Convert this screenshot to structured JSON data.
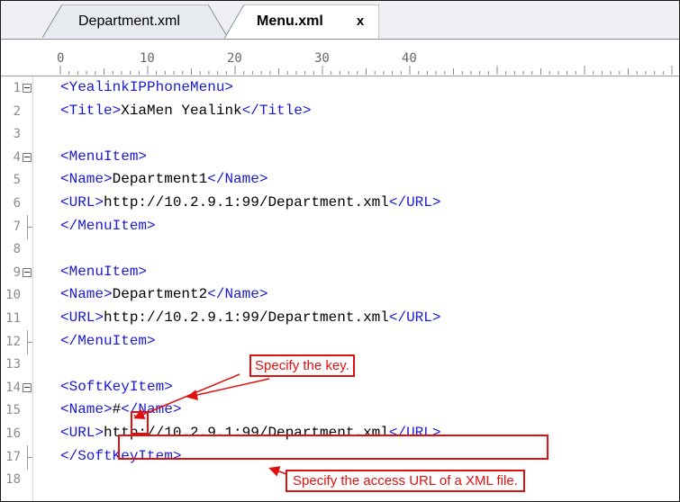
{
  "tabs": [
    {
      "label": "Department.xml",
      "active": false
    },
    {
      "label": "Menu.xml",
      "active": true,
      "close": "x"
    }
  ],
  "ruler": {
    "ticks": [
      "0",
      "10",
      "20",
      "30",
      "40"
    ]
  },
  "code_lines": [
    {
      "n": "1",
      "fold": "open",
      "parts": [
        [
          "tag",
          "<YealinkIPPhoneMenu>"
        ]
      ]
    },
    {
      "n": "2",
      "fold": "",
      "parts": [
        [
          "tag",
          "<Title>"
        ],
        [
          "txt",
          "XiaMen Yealink"
        ],
        [
          "tag",
          "</Title>"
        ]
      ]
    },
    {
      "n": "3",
      "fold": "",
      "parts": []
    },
    {
      "n": "4",
      "fold": "open",
      "parts": [
        [
          "tag",
          "<MenuItem>"
        ]
      ]
    },
    {
      "n": "5",
      "fold": "",
      "parts": [
        [
          "tag",
          "<Name>"
        ],
        [
          "txt",
          "Department1"
        ],
        [
          "tag",
          "</Name>"
        ]
      ]
    },
    {
      "n": "6",
      "fold": "",
      "parts": [
        [
          "tag",
          "<URL>"
        ],
        [
          "txt",
          "http://10.2.9.1:99/Department.xml"
        ],
        [
          "tag",
          "</URL>"
        ]
      ]
    },
    {
      "n": "7",
      "fold": "end",
      "parts": [
        [
          "tag",
          "</MenuItem>"
        ]
      ]
    },
    {
      "n": "8",
      "fold": "",
      "parts": []
    },
    {
      "n": "9",
      "fold": "open",
      "parts": [
        [
          "tag",
          "<MenuItem>"
        ]
      ]
    },
    {
      "n": "10",
      "fold": "",
      "parts": [
        [
          "tag",
          "<Name>"
        ],
        [
          "txt",
          "Department2"
        ],
        [
          "tag",
          "</Name>"
        ]
      ]
    },
    {
      "n": "11",
      "fold": "",
      "parts": [
        [
          "tag",
          "<URL>"
        ],
        [
          "txt",
          "http://10.2.9.1:99/Department.xml"
        ],
        [
          "tag",
          "</URL>"
        ]
      ]
    },
    {
      "n": "12",
      "fold": "end",
      "parts": [
        [
          "tag",
          "</MenuItem>"
        ]
      ]
    },
    {
      "n": "13",
      "fold": "",
      "parts": []
    },
    {
      "n": "14",
      "fold": "open",
      "parts": [
        [
          "tag",
          "<SoftKeyItem>"
        ]
      ]
    },
    {
      "n": "15",
      "fold": "",
      "parts": [
        [
          "tag",
          "<Name>"
        ],
        [
          "txt",
          "#"
        ],
        [
          "tag",
          "</Name>"
        ]
      ]
    },
    {
      "n": "16",
      "fold": "",
      "parts": [
        [
          "tag",
          "<URL>"
        ],
        [
          "txt",
          "http://10.2.9.1:99/Department.xml"
        ],
        [
          "tag",
          "</URL>"
        ]
      ]
    },
    {
      "n": "17",
      "fold": "end",
      "parts": [
        [
          "tag",
          "</SoftKeyItem>"
        ]
      ]
    },
    {
      "n": "18",
      "fold": "",
      "parts": []
    }
  ],
  "annotations": {
    "key_note": "Specify the key.",
    "url_note": "Specify the access URL of a XML file."
  },
  "colors": {
    "tag": "#1a1ad0",
    "text": "#000000",
    "annotation": "#e01010",
    "line_number": "#8c8c8c"
  }
}
